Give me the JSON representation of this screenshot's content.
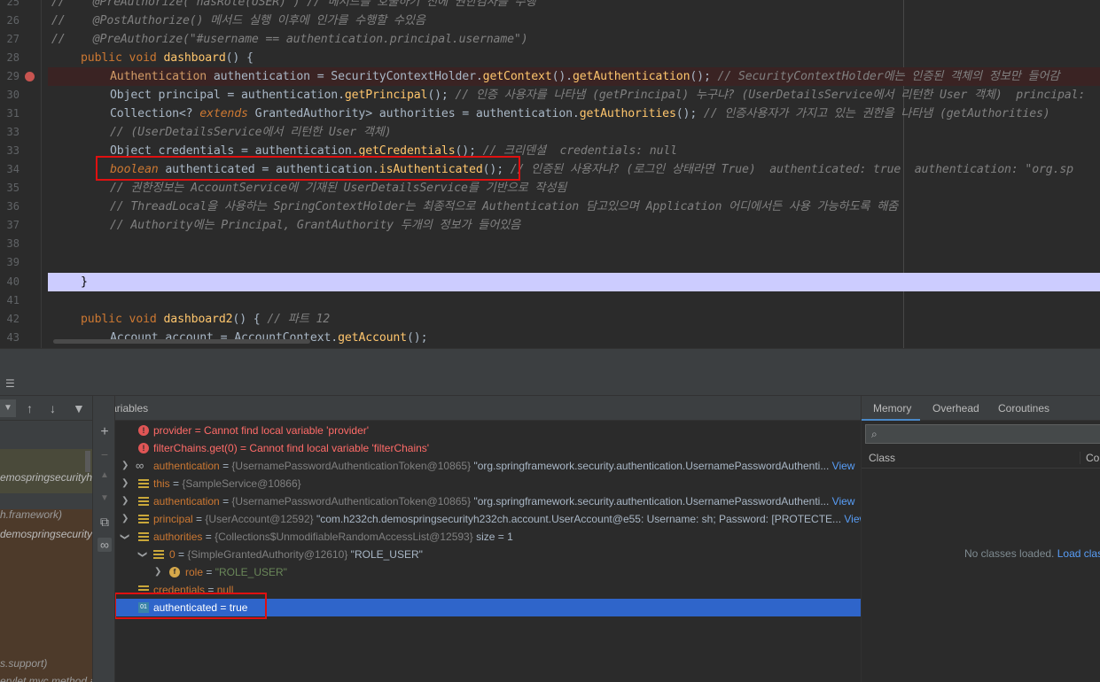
{
  "editor": {
    "line_numbers": [
      "25",
      "26",
      "27",
      "28",
      "29",
      "30",
      "31",
      "33",
      "33",
      "34",
      "35",
      "36",
      "37",
      "38",
      "39",
      "40",
      "41",
      "42",
      "43"
    ],
    "lines": {
      "l25": {
        "comment": "//    @PreAuthorize(\"hasRole(USER)\") // 메서드를 호출하기 전에 권한검사를 수행"
      },
      "l26": {
        "comment": "//    @PostAuthorize() 메서드 실행 이후에 인가를 수행할 수있음"
      },
      "l27": {
        "comment": "//    @PreAuthorize(\"#username == authentication.principal.username\")"
      },
      "l28": {
        "kw1": "public",
        "kw2": "void",
        "fn": "dashboard",
        "rest": "() {"
      },
      "l29": {
        "type": "Authentication",
        "var": " authentication = ",
        "cls": "SecurityContextHolder",
        "dot1": ".",
        "m1": "getContext",
        "p1": "().",
        "m2": "getAuthentication",
        "p2": "();",
        "comment": " // SecurityContextHolder에는 인증된 객체의 정보만 들어감"
      },
      "l30": {
        "type": "Object",
        "var": " principal = authentication.",
        "m1": "getPrincipal",
        "p1": "();",
        "comment": " // 인증 사용자를 나타냄 (getPrincipal) 누구냐? (UserDetailsService에서 리턴한 User 객체)  principal:"
      },
      "l31": {
        "type": "Collection<? ",
        "kw": "extends",
        "type2": " GrantedAuthority> authorities = authentication.",
        "m1": "getAuthorities",
        "p1": "();",
        "comment": " // 인증사용자가 가지고 있는 권한을 나타냄 (getAuthorities)"
      },
      "l32": {
        "comment": "// (UserDetailsService에서 리턴한 User 객체)"
      },
      "l33": {
        "type": "Object",
        "var": " credentials = authentication.",
        "m1": "getCredentials",
        "p1": "();",
        "comment": " // 크리덴셜  credentials: null"
      },
      "l34": {
        "kw": "boolean",
        "var": " authenticated = authentication.",
        "m1": "isAuthenticated",
        "p1": "();",
        "comment": " // 인증된 사용자냐? (로그인 상태라면 True)  authenticated: true  authentication: \"org.sp"
      },
      "l35": {
        "comment": "// 권한정보는 AccountService에 기재된 UserDetailsService를 기반으로 작성됨"
      },
      "l36": {
        "comment": "// ThreadLocal을 사용하는 SpringContextHolder는 최종적으로 Authentication 담고있으며 Application 어디에서든 사용 가능하도록 해줌"
      },
      "l37": {
        "comment": "// Authority에는 Principal, GrantAuthority 두개의 정보가 들어있음"
      },
      "l40": {
        "brace": "}"
      },
      "l42": {
        "kw1": "public",
        "kw2": "void",
        "fn": "dashboard2",
        "rest": "() { ",
        "comment": "// 파트 12"
      },
      "l43": {
        "type": "Account",
        "var": " account = ",
        "cls": "AccountContext",
        "dot": ".",
        "m1": "getAccount",
        "p1": "();"
      }
    }
  },
  "frames": {
    "items": [
      "emospringsecurityh232",
      "h.framework)",
      "demospringsecurityh2",
      "s.support)",
      "ervlet.mvc.method.a"
    ]
  },
  "variables": {
    "header": "Variables",
    "rows": [
      {
        "name": "provider",
        "eq": " = ",
        "value": "Cannot find local variable 'provider'"
      },
      {
        "name": "filterChains.get(0)",
        "eq": " = ",
        "value": "Cannot find local variable 'filterChains'"
      },
      {
        "name": "authentication",
        "eq": " = ",
        "type": "{UsernamePasswordAuthenticationToken@10865}",
        "value": " \"org.springframework.security.authentication.UsernamePasswordAuthenti...",
        "link": " View"
      },
      {
        "name": "this",
        "eq": " = ",
        "type": "{SampleService@10866}"
      },
      {
        "name": "authentication",
        "eq": " = ",
        "type": "{UsernamePasswordAuthenticationToken@10865}",
        "value": " \"org.springframework.security.authentication.UsernamePasswordAuthenti...",
        "link": " View"
      },
      {
        "name": "principal",
        "eq": " = ",
        "type": "{UserAccount@12592}",
        "value": " \"com.h232ch.demospringsecurityh232ch.account.UserAccount@e55: Username: sh; Password: [PROTECTE...",
        "link": " View"
      },
      {
        "name": "authorities",
        "eq": " = ",
        "type": "{Collections$UnmodifiableRandomAccessList@12593}",
        "value": "  size = 1"
      },
      {
        "name": "0",
        "eq": " = ",
        "type": "{SimpleGrantedAuthority@12610}",
        "value": " \"ROLE_USER\""
      },
      {
        "name": "role",
        "eq": " = ",
        "value": "\"ROLE_USER\""
      },
      {
        "name": "credentials",
        "eq": " = ",
        "value": "null"
      },
      {
        "name": "authenticated",
        "eq": " = ",
        "value": "true"
      }
    ]
  },
  "memory": {
    "tabs": [
      "Memory",
      "Overhead",
      "Coroutines"
    ],
    "col_class": "Class",
    "col_count": "Co",
    "empty_text": "No classes loaded. ",
    "load_link": "Load clas"
  }
}
